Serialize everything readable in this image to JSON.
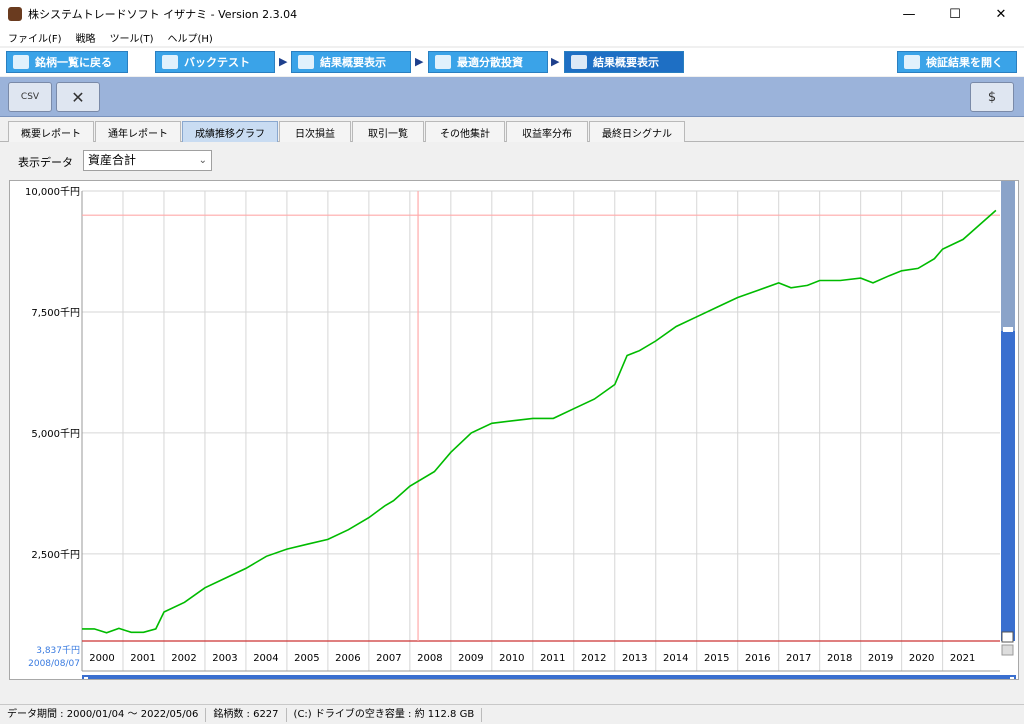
{
  "window": {
    "title": "株システムトレードソフト イザナミ - Version 2.3.04"
  },
  "menu": [
    "ファイル(F)",
    "戦略",
    "ツール(T)",
    "ヘルプ(H)"
  ],
  "nav": {
    "back": "銘柄一覧に戻る",
    "tabs": [
      "バックテスト",
      "結果概要表示",
      "最適分散投資",
      "結果概要表示"
    ],
    "open_results": "検証結果を開く"
  },
  "toolbar": {
    "csv_label": "CSV"
  },
  "subtabs": [
    "概要レポート",
    "通年レポート",
    "成績推移グラフ",
    "日次損益",
    "取引一覧",
    "その他集計",
    "収益率分布",
    "最終日シグナル"
  ],
  "display": {
    "label": "表示データ",
    "selected": "資産合計"
  },
  "chart_data": {
    "type": "line",
    "ylim": [
      700,
      10000
    ],
    "ytick_labels": [
      "10,000千円",
      "7,500千円",
      "5,000千円",
      "2,500千円"
    ],
    "yticks": [
      10000,
      7500,
      5000,
      2500
    ],
    "cursor_readout": {
      "value": "3,837千円",
      "date": "2008/08/07"
    },
    "x_labels": [
      "2000",
      "2001",
      "2002",
      "2003",
      "2004",
      "2005",
      "2006",
      "2007",
      "2008",
      "2009",
      "2010",
      "2011",
      "2012",
      "2013",
      "2014",
      "2015",
      "2016",
      "2017",
      "2018",
      "2019",
      "2020",
      "2021"
    ],
    "series": [
      {
        "color": "#00bb00",
        "x": [
          2000.0,
          2000.3,
          2000.6,
          2000.9,
          2001.2,
          2001.5,
          2001.8,
          2002.0,
          2002.5,
          2003.0,
          2003.5,
          2004.0,
          2004.5,
          2005.0,
          2005.5,
          2006.0,
          2006.5,
          2007.0,
          2007.4,
          2007.6,
          2008.0,
          2008.6,
          2009.0,
          2009.5,
          2010.0,
          2010.5,
          2011.0,
          2011.5,
          2012.0,
          2012.5,
          2013.0,
          2013.3,
          2013.6,
          2014.0,
          2014.5,
          2015.0,
          2015.5,
          2016.0,
          2016.5,
          2017.0,
          2017.3,
          2017.7,
          2018.0,
          2018.5,
          2019.0,
          2019.3,
          2019.7,
          2020.0,
          2020.4,
          2020.8,
          2021.0,
          2021.5,
          2021.9,
          2022.3
        ],
        "y": [
          950,
          950,
          870,
          960,
          880,
          880,
          950,
          1300,
          1500,
          1800,
          2000,
          2200,
          2450,
          2600,
          2700,
          2800,
          3000,
          3250,
          3500,
          3600,
          3900,
          4200,
          4600,
          5000,
          5200,
          5250,
          5300,
          5300,
          5500,
          5700,
          6000,
          6600,
          6700,
          6900,
          7200,
          7400,
          7600,
          7800,
          7950,
          8100,
          8000,
          8050,
          8150,
          8150,
          8200,
          8100,
          8250,
          8350,
          8400,
          8600,
          8800,
          9000,
          9300,
          9600
        ]
      }
    ],
    "reference_lines": [
      {
        "value": 9500,
        "color": "#ffaaaa"
      },
      {
        "value": 700,
        "color": "#cc3333"
      }
    ],
    "cursor_x": 2008.2
  },
  "status": {
    "period": "データ期間 : 2000/01/04 〜 2022/05/06",
    "count": "銘柄数 : 6227",
    "disk": "(C:) ドライブの空き容量 : 約 112.8 GB"
  }
}
